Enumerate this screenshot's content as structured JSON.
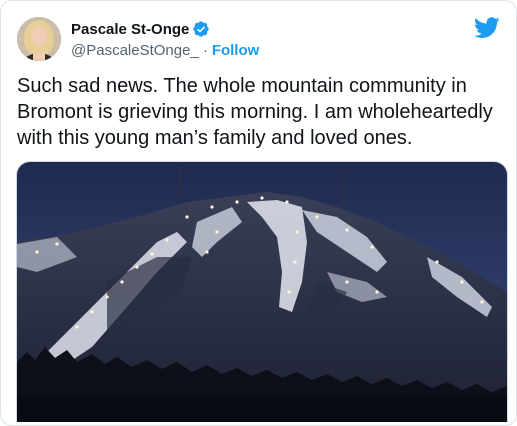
{
  "tweet": {
    "author": {
      "display_name": "Pascale St-Onge",
      "handle": "@PascaleStOnge_",
      "separator": "·",
      "follow_label": "Follow",
      "verified": true
    },
    "text": "Such sad news. The whole mountain community in Bromont is grieving this morning. I am wholeheartedly with this young man’s family and loved ones.",
    "media": {
      "kind": "photo",
      "subject": "night-ski-mountain"
    },
    "brand_icon": "twitter-bird-icon"
  },
  "colors": {
    "accent": "#1d9bf0",
    "text": "#0f1419",
    "secondary_text": "#536471",
    "border": "#cfd9de"
  }
}
